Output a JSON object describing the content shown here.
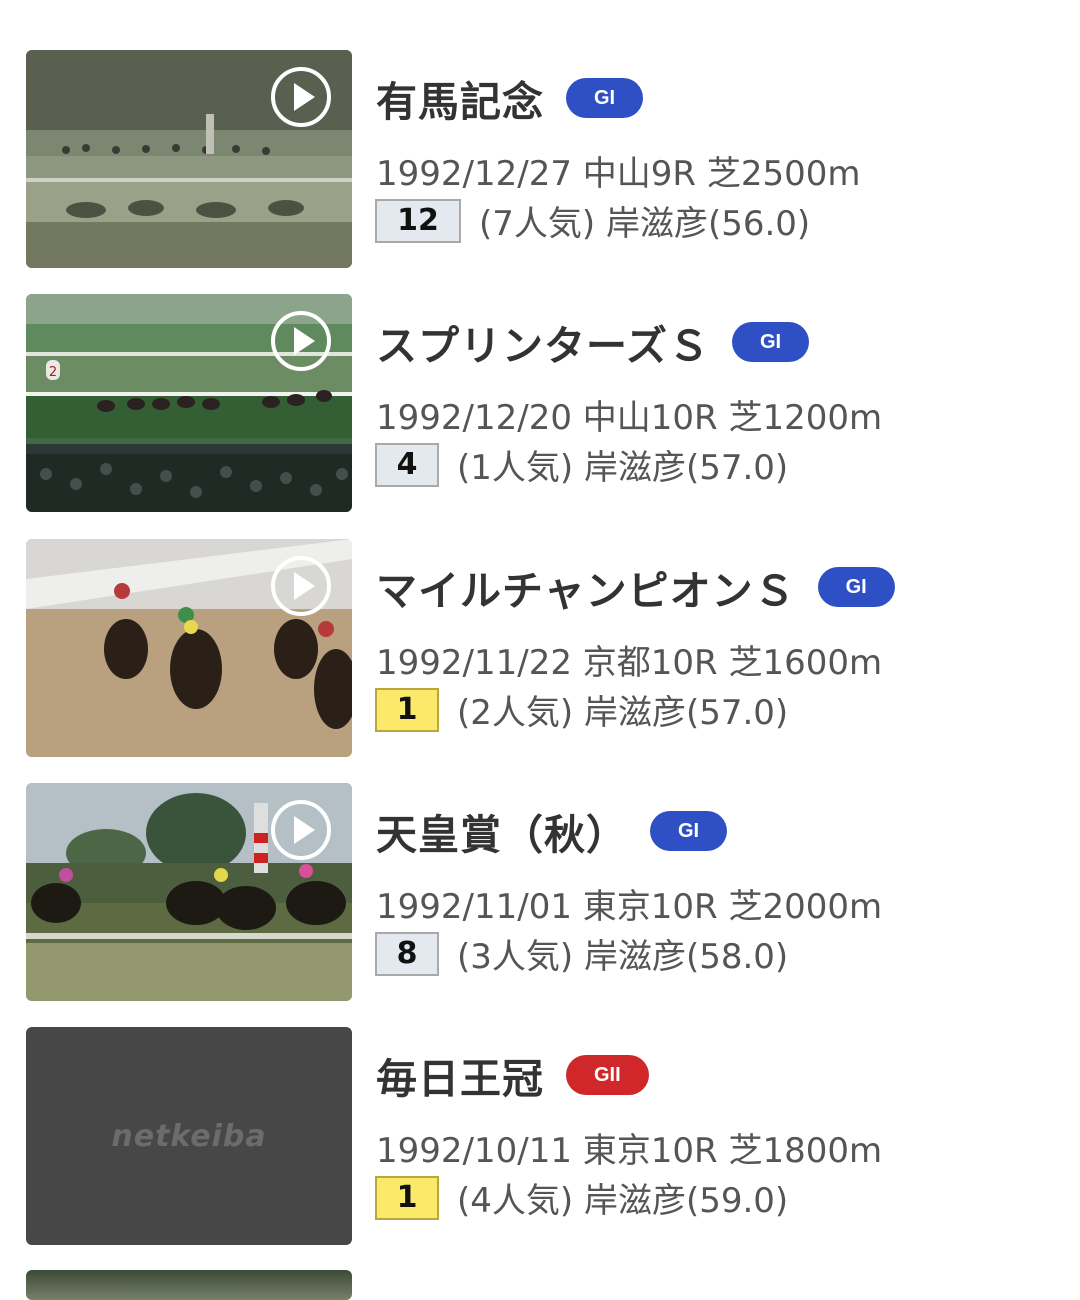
{
  "races": [
    {
      "title": "有馬記念",
      "grade": "GI",
      "info": "1992/12/27 中山9R 芝2500m",
      "rank": "12",
      "detail": "(7人気) 岸滋彦(56.0)",
      "has_video": true
    },
    {
      "title": "スプリンターズＳ",
      "grade": "GI",
      "info": "1992/12/20 中山10R 芝1200m",
      "rank": "4",
      "detail": "(1人気) 岸滋彦(57.0)",
      "has_video": true
    },
    {
      "title": "マイルチャンピオンＳ",
      "grade": "GI",
      "info": "1992/11/22 京都10R 芝1600m",
      "rank": "1",
      "detail": "(2人気) 岸滋彦(57.0)",
      "has_video": true
    },
    {
      "title": "天皇賞（秋）",
      "grade": "GI",
      "info": "1992/11/01 東京10R 芝2000m",
      "rank": "8",
      "detail": "(3人気) 岸滋彦(58.0)",
      "has_video": true
    },
    {
      "title": "毎日王冠",
      "grade": "GII",
      "info": "1992/10/11 東京10R 芝1800m",
      "rank": "1",
      "detail": "(4人気) 岸滋彦(59.0)",
      "has_video": false
    }
  ],
  "placeholder_logo": "netkeiba",
  "colors": {
    "grade_g1": "#2f4fc4",
    "grade_g2": "#d0282a",
    "rank_winner": "#fbe96b",
    "rank_default": "#e4e9ef"
  },
  "icons": {
    "play": "play-circle-icon"
  }
}
